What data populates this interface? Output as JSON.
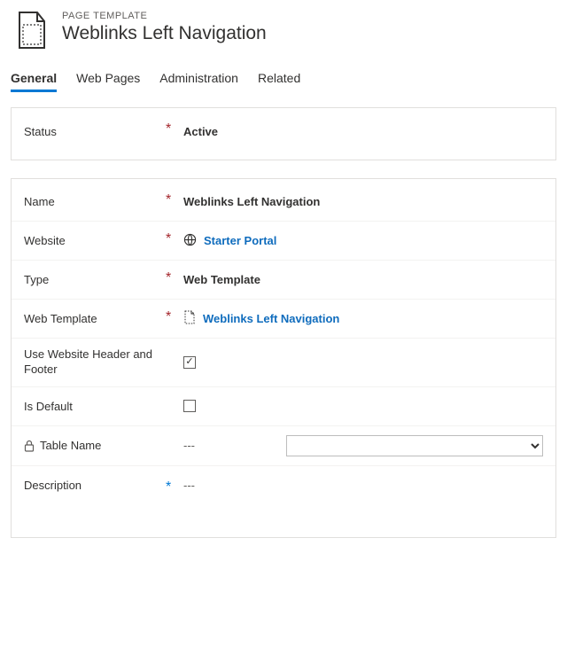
{
  "header": {
    "kicker": "PAGE TEMPLATE",
    "title": "Weblinks Left Navigation"
  },
  "tabs": [
    {
      "label": "General",
      "active": true
    },
    {
      "label": "Web Pages",
      "active": false
    },
    {
      "label": "Administration",
      "active": false
    },
    {
      "label": "Related",
      "active": false
    }
  ],
  "status": {
    "label": "Status",
    "required": true,
    "value": "Active"
  },
  "fields": {
    "name": {
      "label": "Name",
      "required": true,
      "value": "Weblinks Left Navigation"
    },
    "website": {
      "label": "Website",
      "required": true,
      "value": "Starter Portal"
    },
    "type": {
      "label": "Type",
      "required": true,
      "value": "Web Template"
    },
    "web_template": {
      "label": "Web Template",
      "required": true,
      "value": "Weblinks Left Navigation"
    },
    "use_header_footer": {
      "label": "Use Website Header and Footer",
      "checked": true
    },
    "is_default": {
      "label": "Is Default",
      "checked": false
    },
    "table_name": {
      "label": "Table Name",
      "value": "---",
      "locked": true,
      "select_value": ""
    },
    "description": {
      "label": "Description",
      "value": "---"
    }
  }
}
